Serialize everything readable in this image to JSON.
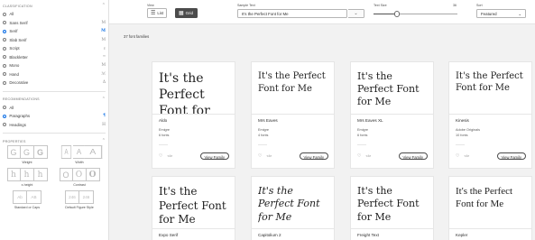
{
  "sidebar": {
    "classification": {
      "title": "CLASSIFICATION",
      "items": [
        {
          "label": "All",
          "icon": "",
          "selected": false
        },
        {
          "label": "Sans Serif",
          "icon": "M",
          "selected": false
        },
        {
          "label": "Serif",
          "icon": "M",
          "selected": true
        },
        {
          "label": "Slab Serif",
          "icon": "M",
          "selected": false
        },
        {
          "label": "Script",
          "icon": "ℓ",
          "selected": false
        },
        {
          "label": "Blackletter",
          "icon": "ᵐ",
          "selected": false
        },
        {
          "label": "Mono",
          "icon": "M",
          "selected": false
        },
        {
          "label": "Hand",
          "icon": "ℳ",
          "selected": false
        },
        {
          "label": "Decorative",
          "icon": "Δ",
          "selected": false
        }
      ]
    },
    "recommendations": {
      "title": "RECOMMENDATIONS",
      "items": [
        {
          "label": "All",
          "icon": "",
          "selected": false
        },
        {
          "label": "Paragraphs",
          "icon": "¶",
          "selected": true
        },
        {
          "label": "Headings",
          "icon": "H",
          "selected": false
        }
      ]
    },
    "properties": {
      "title": "PROPERTIES",
      "groups": [
        {
          "label": "Weight",
          "glyphs": [
            "G",
            "G",
            "G"
          ]
        },
        {
          "label": "Width",
          "glyphs": [
            "A",
            "A",
            "A"
          ]
        },
        {
          "label": "x-height",
          "glyphs": [
            "h",
            "h",
            "h"
          ]
        },
        {
          "label": "Contrast",
          "glyphs": [
            "O",
            "O",
            "O"
          ]
        },
        {
          "label": "Standard or Caps",
          "glyphs": [
            "Ab",
            "AB"
          ]
        },
        {
          "label": "Default Figure Style",
          "glyphs": [
            "246",
            "246"
          ]
        }
      ]
    }
  },
  "toolbar": {
    "view_label": "View",
    "list_label": "List",
    "grid_label": "Grid",
    "sample_label": "Sample Text",
    "sample_value": "It's the Perfect Font for Me",
    "text_size_label": "Text Size",
    "text_size_value": "36",
    "text_size_fraction": 0.28,
    "sort_label": "Sort",
    "sort_value": "Featured"
  },
  "results": {
    "count_text": "37 font families",
    "view_family_label": "View Family",
    "cards": [
      {
        "sample": "It's the Perfect Font for Me",
        "name": "Aldo",
        "foundry": "Emigre",
        "fonts": "6 fonts"
      },
      {
        "sample": "It's the Perfect Font for Me",
        "name": "Mrs Eaves",
        "foundry": "Emigre",
        "fonts": "4 fonts"
      },
      {
        "sample": "It's the Perfect Font for Me",
        "name": "Mrs Eaves XL",
        "foundry": "Emigre",
        "fonts": "6 fonts"
      },
      {
        "sample": "It's the Perfect Font for Me",
        "name": "Kinesis",
        "foundry": "Adobe Originals",
        "fonts": "10 fonts"
      },
      {
        "sample": "It's the Perfect Font for Me",
        "name": "Expo Serif",
        "foundry": "",
        "fonts": ""
      },
      {
        "sample": "It's the Perfect Font for Me",
        "name": "Capitolium 2",
        "foundry": "",
        "fonts": ""
      },
      {
        "sample": "It's the Perfect Font for Me",
        "name": "Freight Text",
        "foundry": "",
        "fonts": ""
      },
      {
        "sample": "It's the Perfect Font for Me",
        "name": "Kepler",
        "foundry": "",
        "fonts": ""
      }
    ]
  },
  "colors": {
    "accent": "#1473e6",
    "selected_view": "#4b4b4b"
  }
}
